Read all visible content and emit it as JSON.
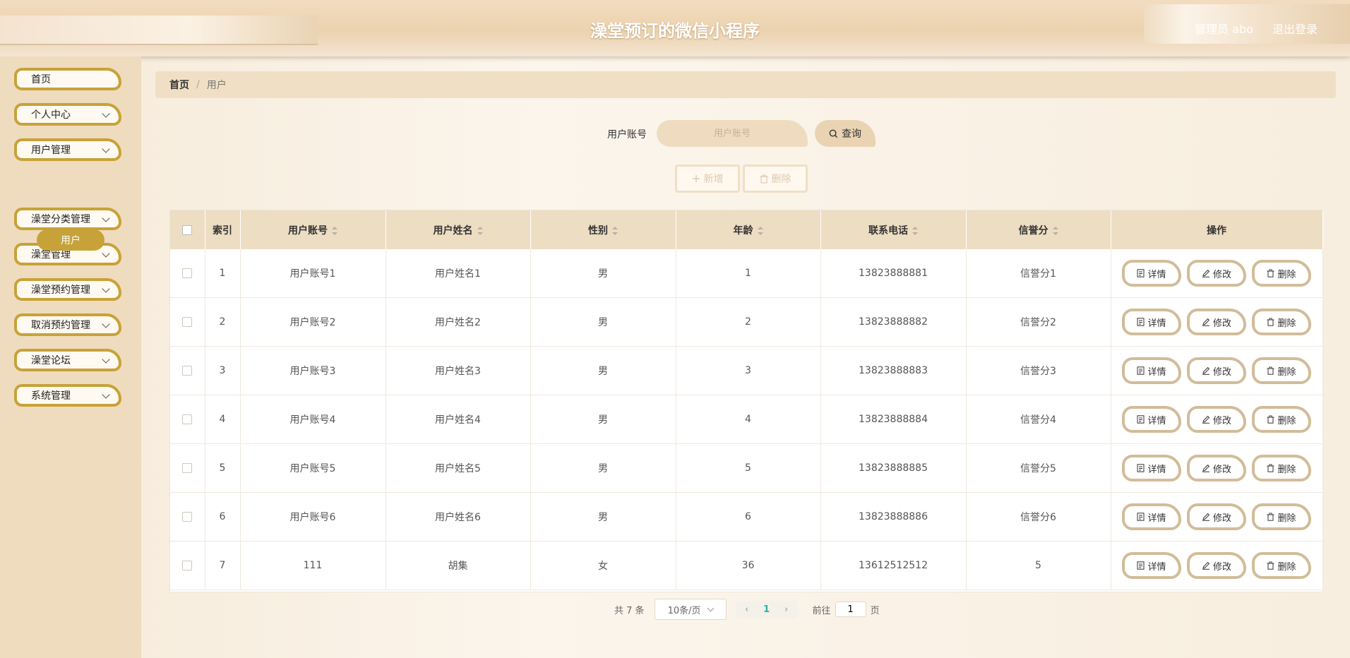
{
  "header": {
    "title": "澡堂预订的微信小程序",
    "user_label": "管理员 abo",
    "logout_label": "退出登录"
  },
  "sidebar": {
    "items": [
      {
        "label": "首页",
        "has_children": false
      },
      {
        "label": "个人中心",
        "has_children": true
      },
      {
        "label": "用户管理",
        "has_children": true
      },
      {
        "label": "澡堂分类管理",
        "has_children": true
      },
      {
        "label": "澡堂管理",
        "has_children": true
      },
      {
        "label": "澡堂预约管理",
        "has_children": true
      },
      {
        "label": "取消预约管理",
        "has_children": true
      },
      {
        "label": "澡堂论坛",
        "has_children": true
      },
      {
        "label": "系统管理",
        "has_children": true
      }
    ],
    "active_sub": "用户"
  },
  "breadcrumb": {
    "home": "首页",
    "separator": "/",
    "current": "用户"
  },
  "search": {
    "label": "用户账号",
    "placeholder": "用户账号",
    "value": "",
    "button_label": "查询"
  },
  "actions": {
    "add_label": "新增",
    "delete_label": "删除"
  },
  "table": {
    "columns": {
      "index": "索引",
      "account": "用户账号",
      "name": "用户姓名",
      "gender": "性别",
      "age": "年龄",
      "phone": "联系电话",
      "credit": "信誉分",
      "ops": "操作"
    },
    "row_buttons": {
      "detail": "详情",
      "edit": "修改",
      "delete": "删除"
    },
    "rows": [
      {
        "index": "1",
        "account": "用户账号1",
        "name": "用户姓名1",
        "gender": "男",
        "age": "1",
        "phone": "13823888881",
        "credit": "信誉分1"
      },
      {
        "index": "2",
        "account": "用户账号2",
        "name": "用户姓名2",
        "gender": "男",
        "age": "2",
        "phone": "13823888882",
        "credit": "信誉分2"
      },
      {
        "index": "3",
        "account": "用户账号3",
        "name": "用户姓名3",
        "gender": "男",
        "age": "3",
        "phone": "13823888883",
        "credit": "信誉分3"
      },
      {
        "index": "4",
        "account": "用户账号4",
        "name": "用户姓名4",
        "gender": "男",
        "age": "4",
        "phone": "13823888884",
        "credit": "信誉分4"
      },
      {
        "index": "5",
        "account": "用户账号5",
        "name": "用户姓名5",
        "gender": "男",
        "age": "5",
        "phone": "13823888885",
        "credit": "信誉分5"
      },
      {
        "index": "6",
        "account": "用户账号6",
        "name": "用户姓名6",
        "gender": "男",
        "age": "6",
        "phone": "13823888886",
        "credit": "信誉分6"
      },
      {
        "index": "7",
        "account": "111",
        "name": "胡集",
        "gender": "女",
        "age": "36",
        "phone": "13612512512",
        "credit": "5"
      }
    ]
  },
  "pagination": {
    "total_label": "共 7 条",
    "page_size_label": "10条/页",
    "current_page": "1",
    "goto_label": "前往",
    "goto_value": "1",
    "page_unit": "页"
  },
  "icons": {
    "search": "search-icon",
    "add": "plus-icon",
    "delete": "trash-icon",
    "detail": "document-icon",
    "edit": "pencil-icon"
  },
  "colors": {
    "accent": "#c7a238",
    "header_bg": "#ecd2ae",
    "sidebar_bg": "#efdbbe",
    "table_header_bg": "#edddc3",
    "button_border": "#d2bc99",
    "page_active": "#2bb3a2"
  }
}
